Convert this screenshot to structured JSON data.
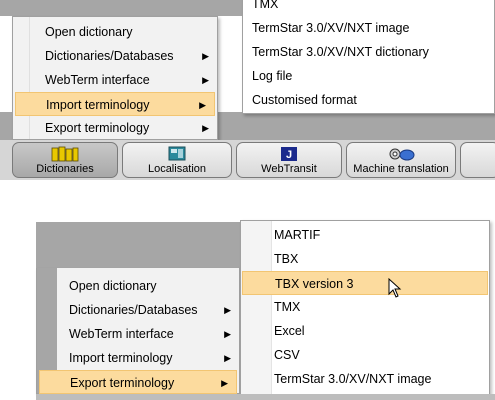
{
  "top_panel": {
    "menu_items": [
      {
        "label": "Open dictionary",
        "has_submenu": false
      },
      {
        "label": "Dictionaries/Databases",
        "has_submenu": true
      },
      {
        "label": "WebTerm interface",
        "has_submenu": true
      },
      {
        "label": "Import terminology",
        "has_submenu": true,
        "selected": true
      },
      {
        "label": "Export terminology",
        "has_submenu": true
      }
    ],
    "submenu_items": [
      {
        "label": "TMX"
      },
      {
        "label": "TermStar 3.0/XV/NXT image"
      },
      {
        "label": "TermStar 3.0/XV/NXT dictionary"
      },
      {
        "label": "Log file"
      },
      {
        "label": "Customised format"
      }
    ],
    "tabs": [
      {
        "label": "Dictionaries",
        "icon": "dictionaries-icon"
      },
      {
        "label": "Localisation",
        "icon": "localisation-icon"
      },
      {
        "label": "WebTransit",
        "icon": "webtransit-icon"
      },
      {
        "label": "Machine translation",
        "icon": "machine-translation-icon"
      }
    ]
  },
  "bottom_panel": {
    "menu_items": [
      {
        "label": "Open dictionary",
        "has_submenu": false
      },
      {
        "label": "Dictionaries/Databases",
        "has_submenu": true
      },
      {
        "label": "WebTerm interface",
        "has_submenu": true
      },
      {
        "label": "Import terminology",
        "has_submenu": true
      },
      {
        "label": "Export terminology",
        "has_submenu": true,
        "selected": true
      }
    ],
    "submenu_items": [
      {
        "label": "MARTIF"
      },
      {
        "label": "TBX"
      },
      {
        "label": "TBX version 3",
        "selected": true
      },
      {
        "label": "TMX"
      },
      {
        "label": "Excel"
      },
      {
        "label": "CSV"
      },
      {
        "label": "TermStar 3.0/XV/NXT image"
      }
    ]
  },
  "colors": {
    "selection": "#fcdb9e",
    "background_grey": "#a6a6a6"
  }
}
